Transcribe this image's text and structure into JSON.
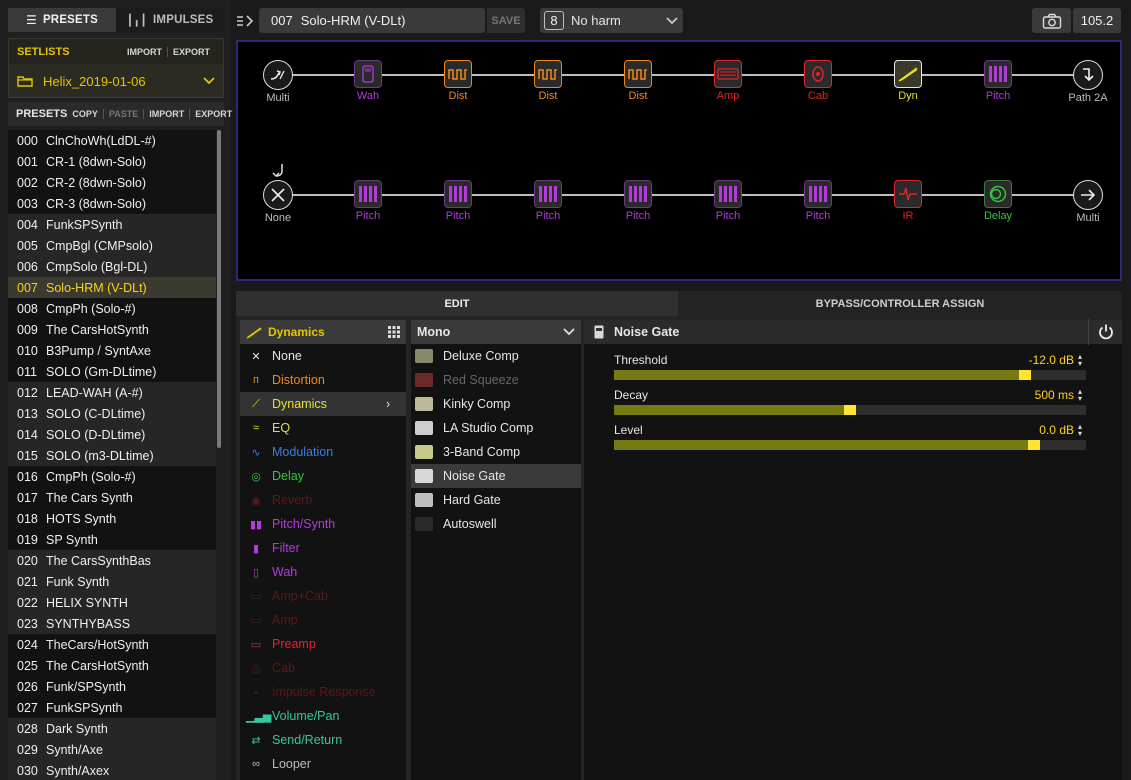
{
  "tabs": {
    "presets": "PRESETS",
    "impulses": "IMPULSES"
  },
  "setlist": {
    "header": "SETLISTS",
    "import": "IMPORT",
    "export": "EXPORT",
    "selected": "Helix_2019-01-06"
  },
  "presets_header": {
    "title": "PRESETS",
    "copy": "COPY",
    "paste": "PASTE",
    "import": "IMPORT",
    "export": "EXPORT"
  },
  "presets": [
    {
      "num": "000",
      "name": "ClnChoWh(LdDL-#)"
    },
    {
      "num": "001",
      "name": "CR-1 (8dwn-Solo)"
    },
    {
      "num": "002",
      "name": "CR-2 (8dwn-Solo)"
    },
    {
      "num": "003",
      "name": "CR-3 (8dwn-Solo)"
    },
    {
      "num": "004",
      "name": "FunkSPSynth"
    },
    {
      "num": "005",
      "name": "CmpBgl (CMPsolo)"
    },
    {
      "num": "006",
      "name": "CmpSolo (Bgl-DL)"
    },
    {
      "num": "007",
      "name": "Solo-HRM (V-DLt)"
    },
    {
      "num": "008",
      "name": "CmpPh (Solo-#)"
    },
    {
      "num": "009",
      "name": "The CarsHotSynth"
    },
    {
      "num": "010",
      "name": "B3Pump / SyntAxe"
    },
    {
      "num": "011",
      "name": "SOLO (Gm-DLtime)"
    },
    {
      "num": "012",
      "name": "LEAD-WAH (A-#)"
    },
    {
      "num": "013",
      "name": "SOLO (C-DLtime)"
    },
    {
      "num": "014",
      "name": "SOLO (D-DLtime)"
    },
    {
      "num": "015",
      "name": "SOLO (m3-DLtime)"
    },
    {
      "num": "016",
      "name": "CmpPh (Solo-#)"
    },
    {
      "num": "017",
      "name": "The Cars Synth"
    },
    {
      "num": "018",
      "name": "HOTS Synth"
    },
    {
      "num": "019",
      "name": "SP Synth"
    },
    {
      "num": "020",
      "name": "The CarsSynthBas"
    },
    {
      "num": "021",
      "name": "Funk Synth"
    },
    {
      "num": "022",
      "name": "HELIX SYNTH"
    },
    {
      "num": "023",
      "name": "SYNTHYBASS"
    },
    {
      "num": "024",
      "name": "TheCars/HotSynth"
    },
    {
      "num": "025",
      "name": "The CarsHotSynth"
    },
    {
      "num": "026",
      "name": "Funk/SPSynth"
    },
    {
      "num": "027",
      "name": "FunkSPSynth"
    },
    {
      "num": "028",
      "name": "Dark Synth"
    },
    {
      "num": "029",
      "name": "Synth/Axe"
    },
    {
      "num": "030",
      "name": "Synth/Axex"
    }
  ],
  "selected_preset_index": 7,
  "topbar": {
    "preset_num": "007",
    "preset_name": "Solo-HRM (V-DLt)",
    "save": "SAVE",
    "snapshot_num": "8",
    "snapshot_name": "No harm",
    "tempo": "105.2"
  },
  "path1": [
    {
      "label": "Multi",
      "color": "#bdbdbd",
      "icon": "multi-input-icon"
    },
    {
      "label": "Wah",
      "color": "#b23cd9",
      "icon": "wah-icon"
    },
    {
      "label": "Dist",
      "color": "#f08a1c",
      "icon": "dist-icon"
    },
    {
      "label": "Dist",
      "color": "#f08a1c",
      "icon": "dist-icon"
    },
    {
      "label": "Dist",
      "color": "#f08a1c",
      "icon": "dist-icon"
    },
    {
      "label": "Amp",
      "color": "#e0262b",
      "icon": "amp-icon"
    },
    {
      "label": "Cab",
      "color": "#e0262b",
      "icon": "cab-icon"
    },
    {
      "label": "Dyn",
      "color": "#e6e02a",
      "icon": "dyn-icon"
    },
    {
      "label": "Pitch",
      "color": "#b23cd9",
      "icon": "pitch-icon"
    },
    {
      "label": "Path 2A",
      "color": "#bdbdbd",
      "icon": "path-split-icon"
    }
  ],
  "path2": [
    {
      "label": "None",
      "color": "#bdbdbd",
      "icon": "none-input-icon"
    },
    {
      "label": "Pitch",
      "color": "#b23cd9",
      "icon": "pitch-icon"
    },
    {
      "label": "Pitch",
      "color": "#b23cd9",
      "icon": "pitch-icon"
    },
    {
      "label": "Pitch",
      "color": "#b23cd9",
      "icon": "pitch-icon"
    },
    {
      "label": "Pitch",
      "color": "#b23cd9",
      "icon": "pitch-icon"
    },
    {
      "label": "Pitch",
      "color": "#b23cd9",
      "icon": "pitch-icon"
    },
    {
      "label": "Pitch",
      "color": "#b23cd9",
      "icon": "pitch-icon"
    },
    {
      "label": "IR",
      "color": "#e0262b",
      "icon": "ir-icon"
    },
    {
      "label": "Delay",
      "color": "#35c83a",
      "icon": "delay-icon"
    },
    {
      "label": "Multi",
      "color": "#bdbdbd",
      "icon": "multi-output-icon"
    }
  ],
  "edit_tabs": {
    "edit": "EDIT",
    "bypass": "BYPASS/CONTROLLER ASSIGN"
  },
  "category_header": "Dynamics",
  "categories": [
    {
      "label": "None",
      "color": "#e6e6e6",
      "icon": "none-icon"
    },
    {
      "label": "Distortion",
      "color": "#f08a1c",
      "icon": "distortion-icon"
    },
    {
      "label": "Dynamics",
      "color": "#e6e02a",
      "icon": "dynamics-icon"
    },
    {
      "label": "EQ",
      "color": "#e6e02a",
      "icon": "eq-icon"
    },
    {
      "label": "Modulation",
      "color": "#3a7fe0",
      "icon": "modulation-icon"
    },
    {
      "label": "Delay",
      "color": "#35c83a",
      "icon": "delay-icon"
    },
    {
      "label": "Reverb",
      "color": "#5a1a1a",
      "icon": "reverb-icon"
    },
    {
      "label": "Pitch/Synth",
      "color": "#b23cd9",
      "icon": "pitch-icon"
    },
    {
      "label": "Filter",
      "color": "#b23cd9",
      "icon": "filter-icon"
    },
    {
      "label": "Wah",
      "color": "#b23cd9",
      "icon": "wah-icon"
    },
    {
      "label": "Amp+Cab",
      "color": "#5a1a1a",
      "icon": "ampcab-icon"
    },
    {
      "label": "Amp",
      "color": "#5a1a1a",
      "icon": "amp-icon"
    },
    {
      "label": "Preamp",
      "color": "#e0262b",
      "icon": "preamp-icon"
    },
    {
      "label": "Cab",
      "color": "#5a1a1a",
      "icon": "cab-icon"
    },
    {
      "label": "Impulse Response",
      "color": "#5a1a1a",
      "icon": "ir-icon"
    },
    {
      "label": "Volume/Pan",
      "color": "#35c8a0",
      "icon": "volume-icon"
    },
    {
      "label": "Send/Return",
      "color": "#35c8a0",
      "icon": "send-return-icon"
    },
    {
      "label": "Looper",
      "color": "#bdbdbd",
      "icon": "looper-icon"
    }
  ],
  "selected_category_index": 2,
  "model_header": "Mono",
  "models": [
    {
      "label": "Deluxe Comp",
      "dim": false,
      "icon": "deluxe-comp-icon"
    },
    {
      "label": "Red Squeeze",
      "dim": true,
      "icon": "red-squeeze-icon"
    },
    {
      "label": "Kinky Comp",
      "dim": false,
      "icon": "kinky-comp-icon"
    },
    {
      "label": "LA Studio Comp",
      "dim": false,
      "icon": "la-studio-comp-icon"
    },
    {
      "label": "3-Band Comp",
      "dim": false,
      "icon": "3-band-comp-icon"
    },
    {
      "label": "Noise Gate",
      "dim": false,
      "icon": "noise-gate-icon"
    },
    {
      "label": "Hard Gate",
      "dim": false,
      "icon": "hard-gate-icon"
    },
    {
      "label": "Autoswell",
      "dim": false,
      "icon": "autoswell-icon"
    }
  ],
  "selected_model_index": 5,
  "block_title": "Noise Gate",
  "params": [
    {
      "name": "Threshold",
      "value": "-12.0 dB",
      "fraction": 0.88
    },
    {
      "name": "Decay",
      "value": "500 ms",
      "fraction": 0.5
    },
    {
      "name": "Level",
      "value": "0.0 dB",
      "fraction": 0.9
    }
  ],
  "accent_yellow": "#ffd21a"
}
